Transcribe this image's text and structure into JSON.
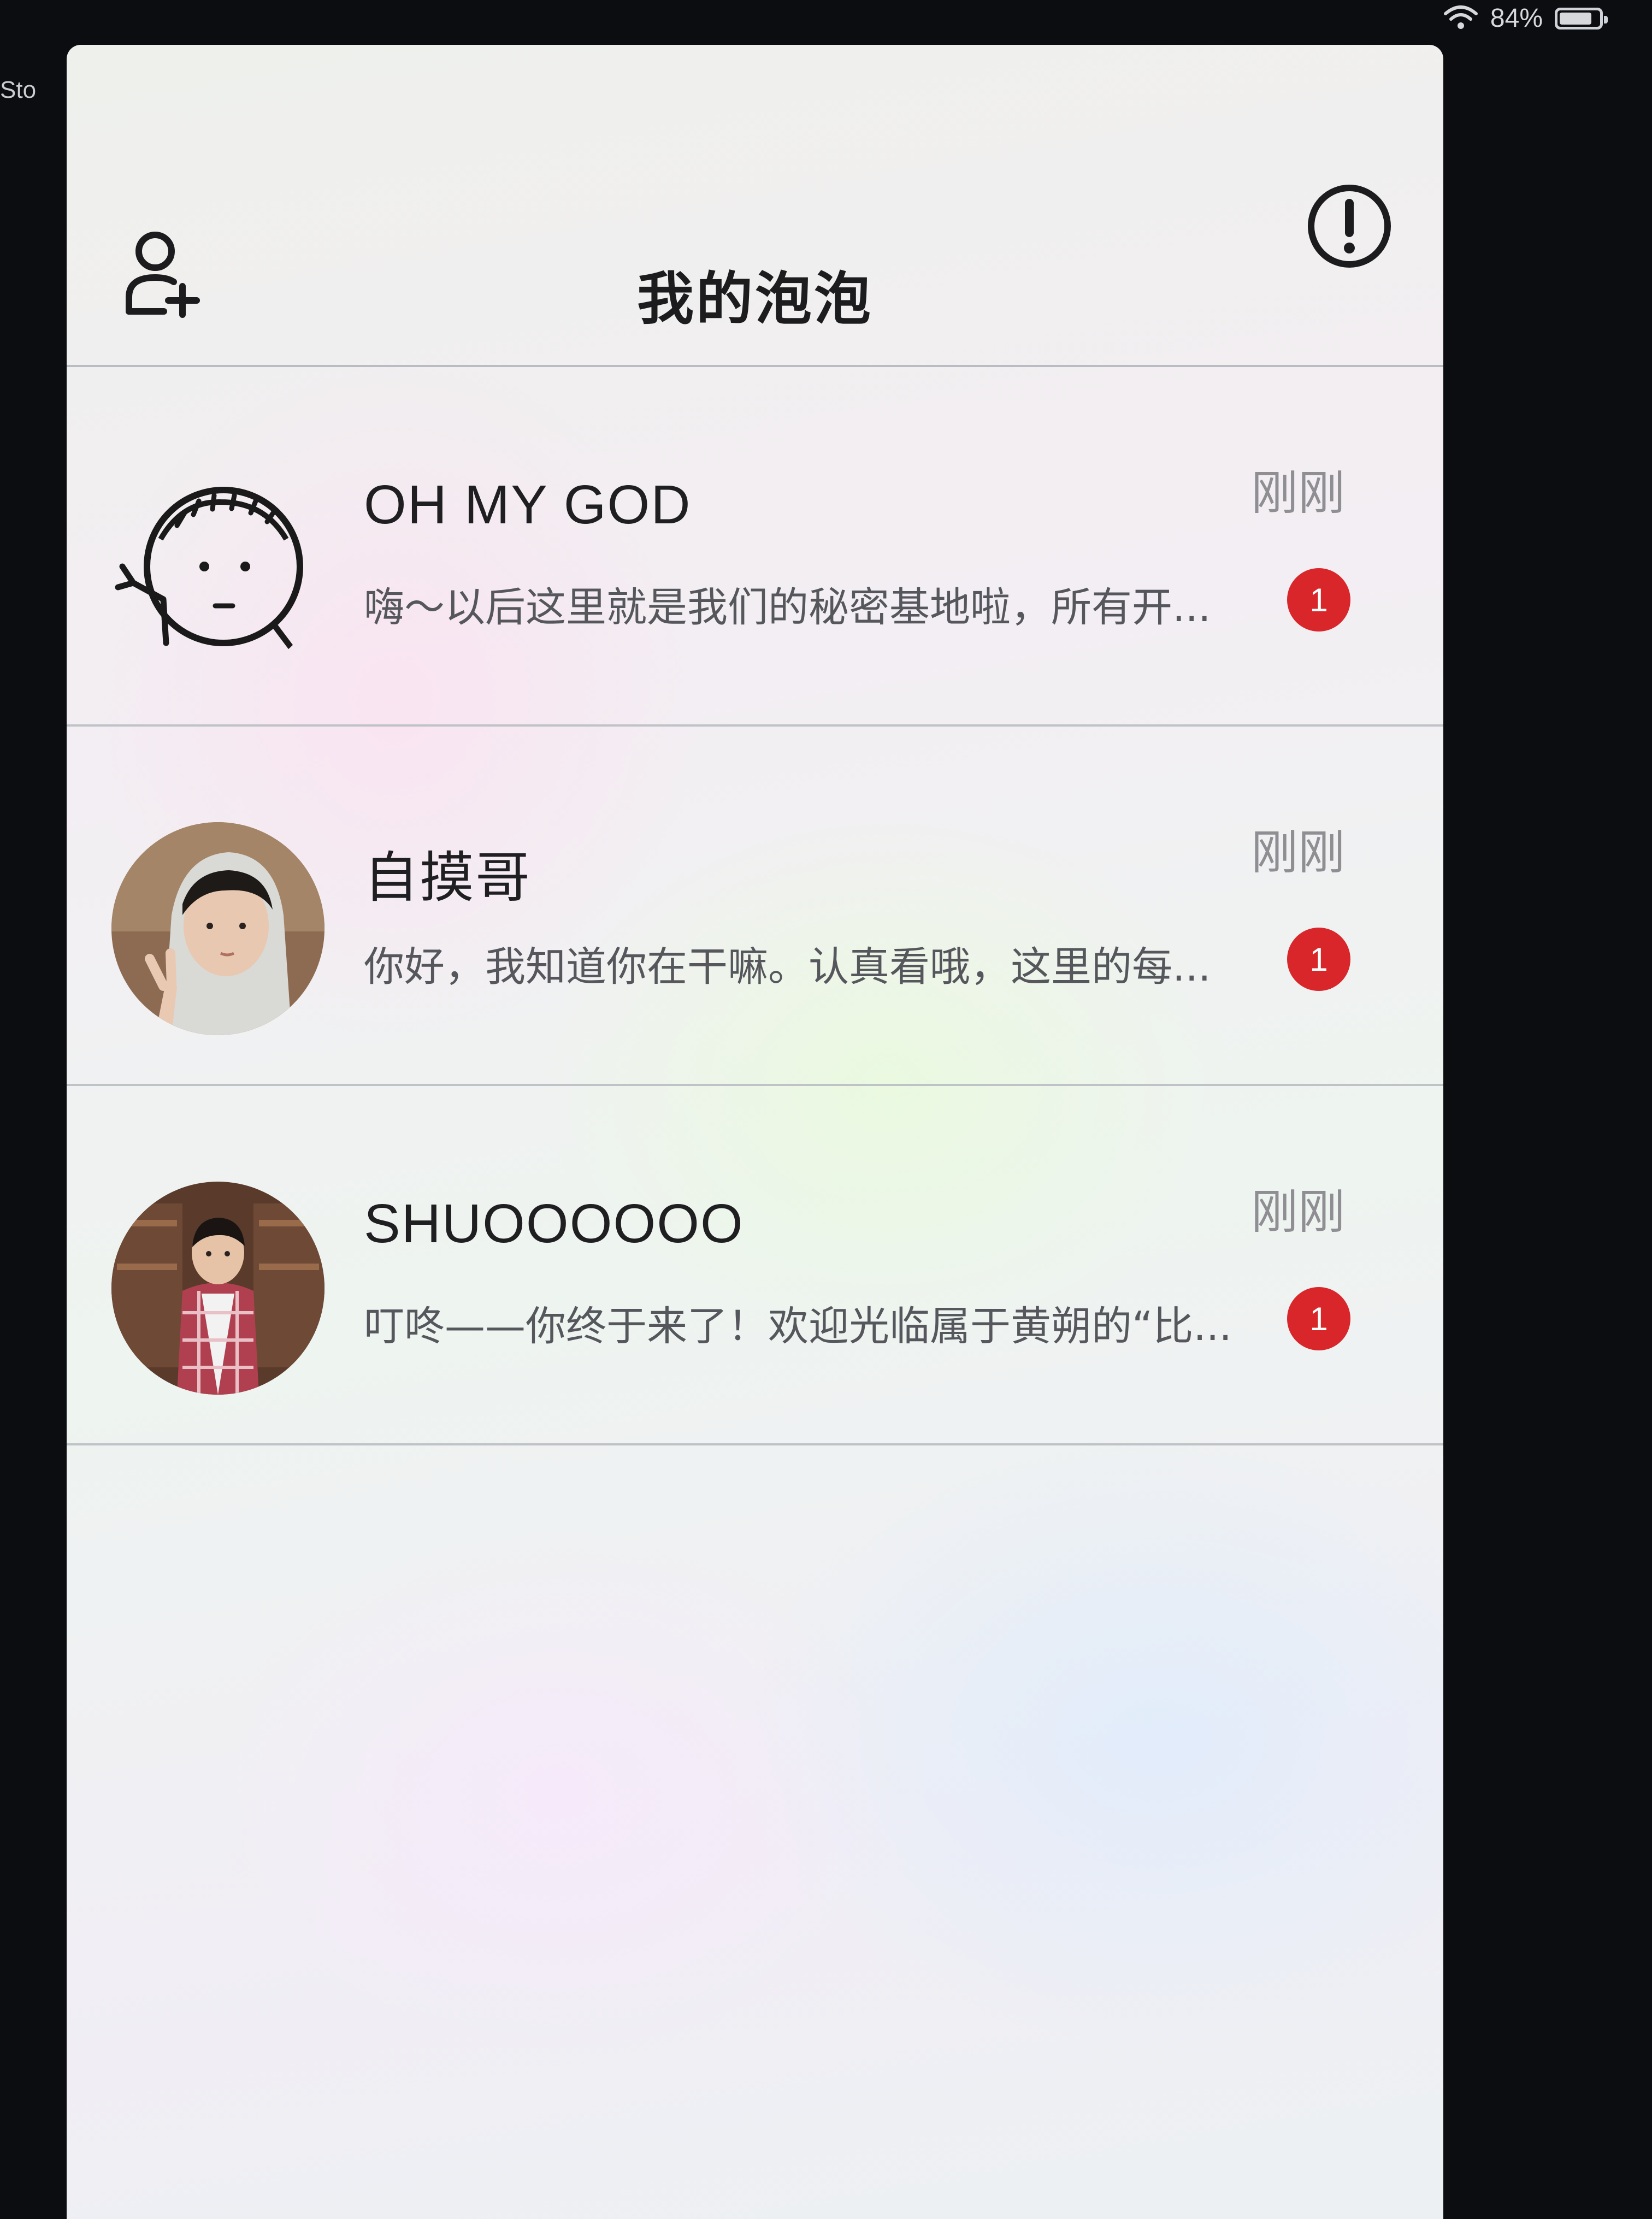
{
  "status_bar": {
    "battery_text": "84%",
    "battery_level": 0.84,
    "background_label": "Sto"
  },
  "header": {
    "title": "我的泡泡",
    "left_icon": "add-user-icon",
    "right_icon": "exclamation-circle-icon"
  },
  "chats": [
    {
      "name": "OH MY GOD",
      "time": "刚刚",
      "preview": "嗨～以后这里就是我们的秘密基地啦，所有开...",
      "unread": "1",
      "avatar": "doodle-boy-avatar"
    },
    {
      "name": "自摸哥",
      "time": "刚刚",
      "preview": "你好，我知道你在干嘛。认真看哦，这里的每...",
      "unread": "1",
      "avatar": "hooded-boy-photo-avatar"
    },
    {
      "name": "SHUOOOOOO",
      "time": "刚刚",
      "preview": "叮咚——你终于来了！欢迎光临属于黄朔的“比...",
      "unread": "1",
      "avatar": "kid-plaid-shirt-photo-avatar"
    }
  ],
  "colors": {
    "badge": "#d8262a",
    "title_text": "#1c1c1e",
    "secondary_text": "#8e8e93"
  }
}
